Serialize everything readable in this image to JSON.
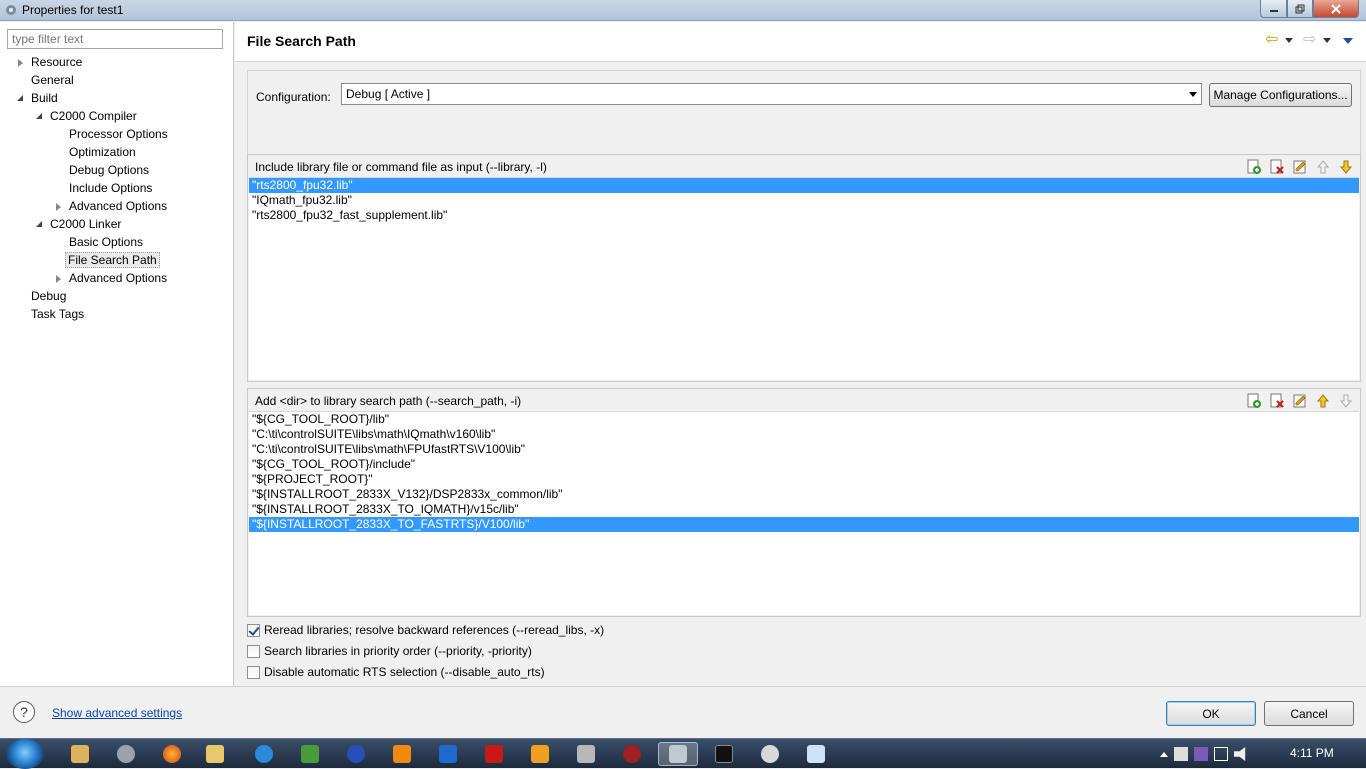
{
  "window": {
    "title": "Properties for test1"
  },
  "filter": {
    "placeholder": "type filter text"
  },
  "tree": {
    "resource": "Resource",
    "general": "General",
    "build": "Build",
    "c2000_compiler": "C2000 Compiler",
    "processor_options": "Processor Options",
    "optimization": "Optimization",
    "debug_options": "Debug Options",
    "include_options": "Include Options",
    "advanced_options_compiler": "Advanced Options",
    "c2000_linker": "C2000 Linker",
    "basic_options": "Basic Options",
    "file_search_path": "File Search Path",
    "advanced_options_linker": "Advanced Options",
    "debug": "Debug",
    "task_tags": "Task Tags"
  },
  "page": {
    "title": "File Search Path",
    "config_label": "Configuration:",
    "config_value": "Debug  [ Active ]",
    "manage_button": "Manage Configurations..."
  },
  "library_group": {
    "title": "Include library file or command file as input (--library, -l)",
    "items": [
      "\"rts2800_fpu32.lib\"",
      "\"IQmath_fpu32.lib\"",
      "\"rts2800_fpu32_fast_supplement.lib\""
    ],
    "selected_index": 0
  },
  "search_path_group": {
    "title": "Add <dir> to library search path (--search_path, -i)",
    "items": [
      "\"${CG_TOOL_ROOT}/lib\"",
      "\"C:\\ti\\controlSUITE\\libs\\math\\IQmath\\v160\\lib\"",
      "\"C:\\ti\\controlSUITE\\libs\\math\\FPUfastRTS\\V100\\lib\"",
      "\"${CG_TOOL_ROOT}/include\"",
      "\"${PROJECT_ROOT}\"",
      "\"${INSTALLROOT_2833X_V132}/DSP2833x_common/lib\"",
      "\"${INSTALLROOT_2833X_TO_IQMATH}/v15c/lib\"",
      "\"${INSTALLROOT_2833X_TO_FASTRTS}/V100/lib\""
    ],
    "selected_index": 7
  },
  "checkboxes": {
    "reread": {
      "label": "Reread libraries; resolve backward references (--reread_libs, -x)",
      "checked": true
    },
    "priority": {
      "label": "Search libraries in priority order (--priority, -priority)",
      "checked": false
    },
    "disable_rts": {
      "label": "Disable automatic RTS selection (--disable_auto_rts)",
      "checked": false
    }
  },
  "footer": {
    "help_icon": "?",
    "advanced_link": "Show advanced settings",
    "ok": "OK",
    "cancel": "Cancel"
  },
  "taskbar": {
    "clock": "4:11 PM"
  }
}
